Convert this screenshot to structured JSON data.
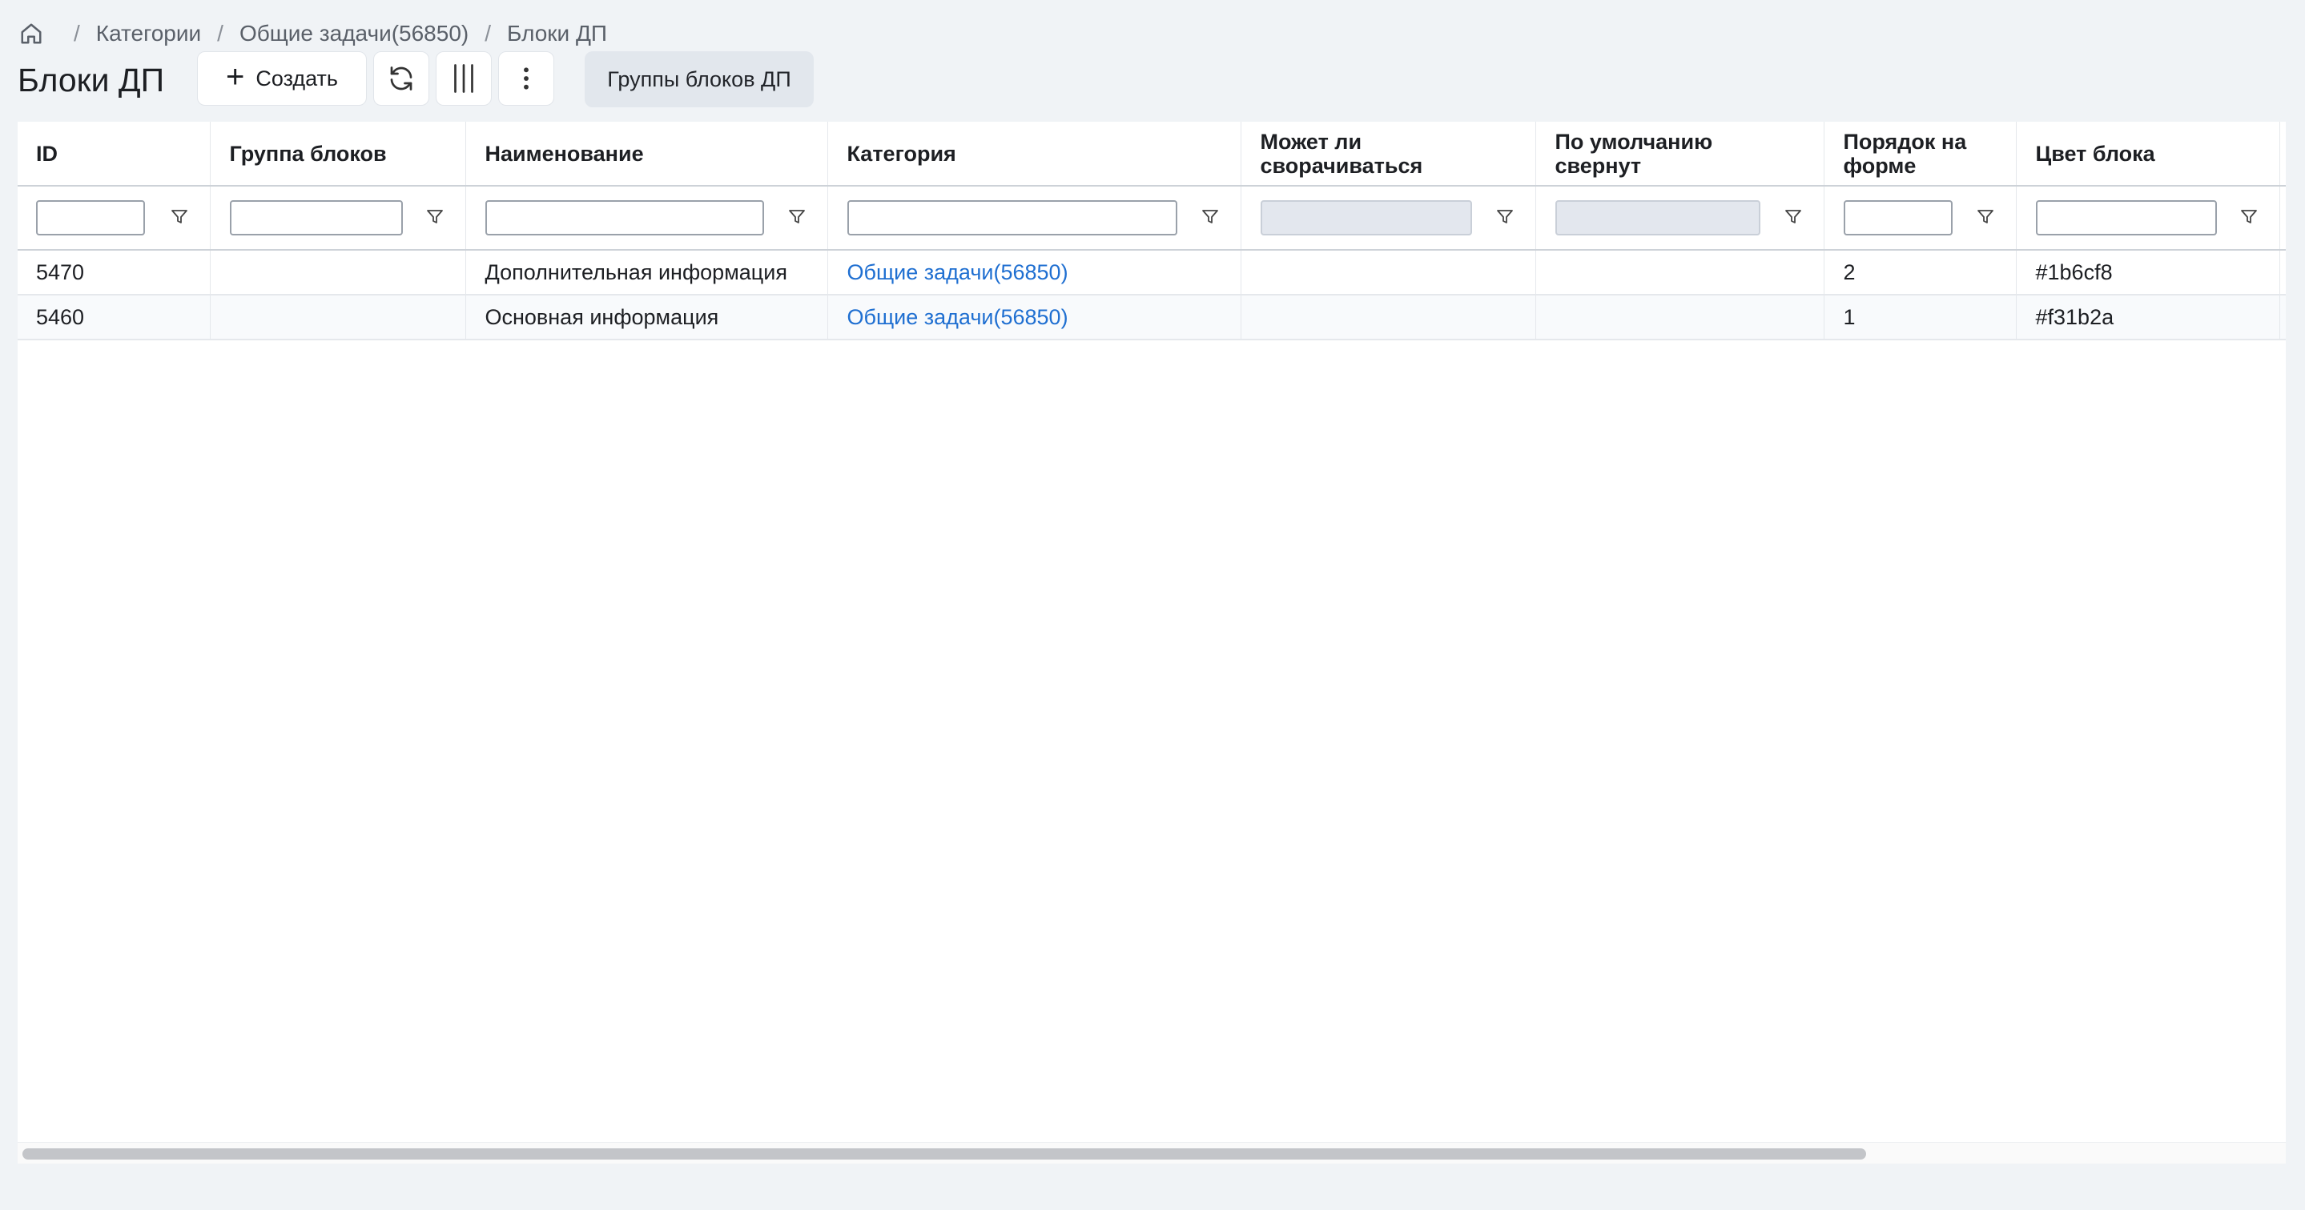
{
  "breadcrumb": {
    "home_icon": "home-icon",
    "items": [
      "Категории",
      "Общие задачи(56850)",
      "Блоки ДП"
    ]
  },
  "page": {
    "title": "Блоки ДП"
  },
  "toolbar": {
    "create_label": "Создать",
    "refresh_icon": "refresh-icon",
    "columns_icon": "columns-icon",
    "more_icon": "more-vertical-icon",
    "groups_label": "Группы блоков ДП"
  },
  "table": {
    "columns": [
      "ID",
      "Группа блоков",
      "Наименование",
      "Категория",
      "Может ли сворачиваться",
      "По умолчанию свернут",
      "Порядок на форме",
      "Цвет блока"
    ],
    "rows": [
      {
        "id": "5470",
        "group": "",
        "name": "Дополнительная информация",
        "category": "Общие задачи(56850)",
        "collapsible": "",
        "collapsed": "",
        "order": "2",
        "color": "#1b6cf8"
      },
      {
        "id": "5460",
        "group": "",
        "name": "Основная информация",
        "category": "Общие задачи(56850)",
        "collapsible": "",
        "collapsed": "",
        "order": "1",
        "color": "#f31b2a"
      }
    ]
  },
  "colors": {
    "link": "#1f6fd1",
    "background": "#f0f3f6"
  }
}
